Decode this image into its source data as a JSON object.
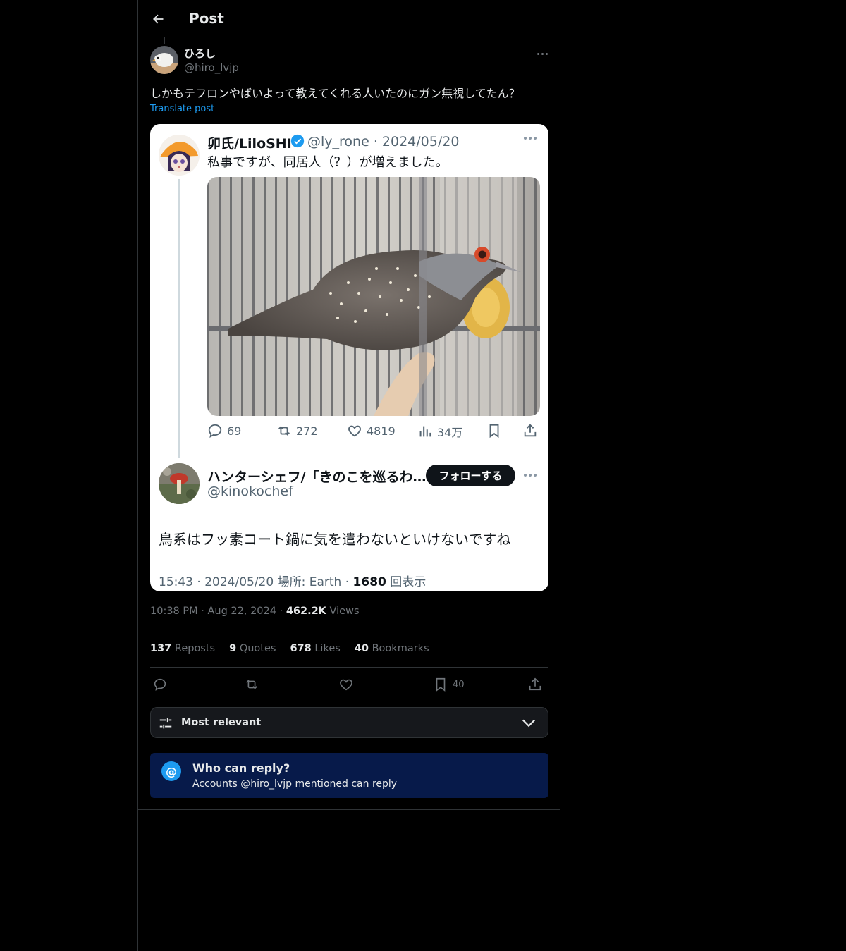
{
  "header": {
    "title": "Post"
  },
  "author": {
    "name": "ひろし",
    "handle": "@hiro_lvjp"
  },
  "post": {
    "text": "しかもテフロンやばいよって教えてくれる人いたのにガン無視してたん？",
    "translate_label": "Translate post"
  },
  "screenshot": {
    "quoted": {
      "name": "卯氏/LiloSHI",
      "meta": "@ly_rone · 2024/05/20",
      "text": "私事ですが、同居人（？）が増えました。",
      "replies": "69",
      "reposts": "272",
      "likes": "4819",
      "views": "34万"
    },
    "reply": {
      "name": "ハンターシェフ/「きのこを巡るわ…",
      "handle": "@kinokochef",
      "follow_label": "フォローする",
      "text": "鳥系はフッ素コート鍋に気を遣わないといけないですね",
      "meta_prefix": "15:43 · 2024/05/20 場所: Earth · ",
      "meta_views": "1680",
      "meta_suffix": " 回表示"
    }
  },
  "timestamp": {
    "time": "10:38 PM",
    "date": "Aug 22, 2024",
    "views_count": "462.2K",
    "views_label": "Views"
  },
  "stats": {
    "reposts_count": "137",
    "reposts_label": "Reposts",
    "quotes_count": "9",
    "quotes_label": "Quotes",
    "likes_count": "678",
    "likes_label": "Likes",
    "bookmarks_count": "40",
    "bookmarks_label": "Bookmarks"
  },
  "actions": {
    "bookmark_count": "40"
  },
  "sort": {
    "label": "Most relevant"
  },
  "who_can_reply": {
    "icon": "@",
    "title": "Who can reply?",
    "subtitle": "Accounts @hiro_lvjp mentioned can reply"
  },
  "colors": {
    "accent": "#1d9bf0",
    "background": "#000000",
    "muted": "#71767b",
    "notice_bg": "#071a4a"
  }
}
